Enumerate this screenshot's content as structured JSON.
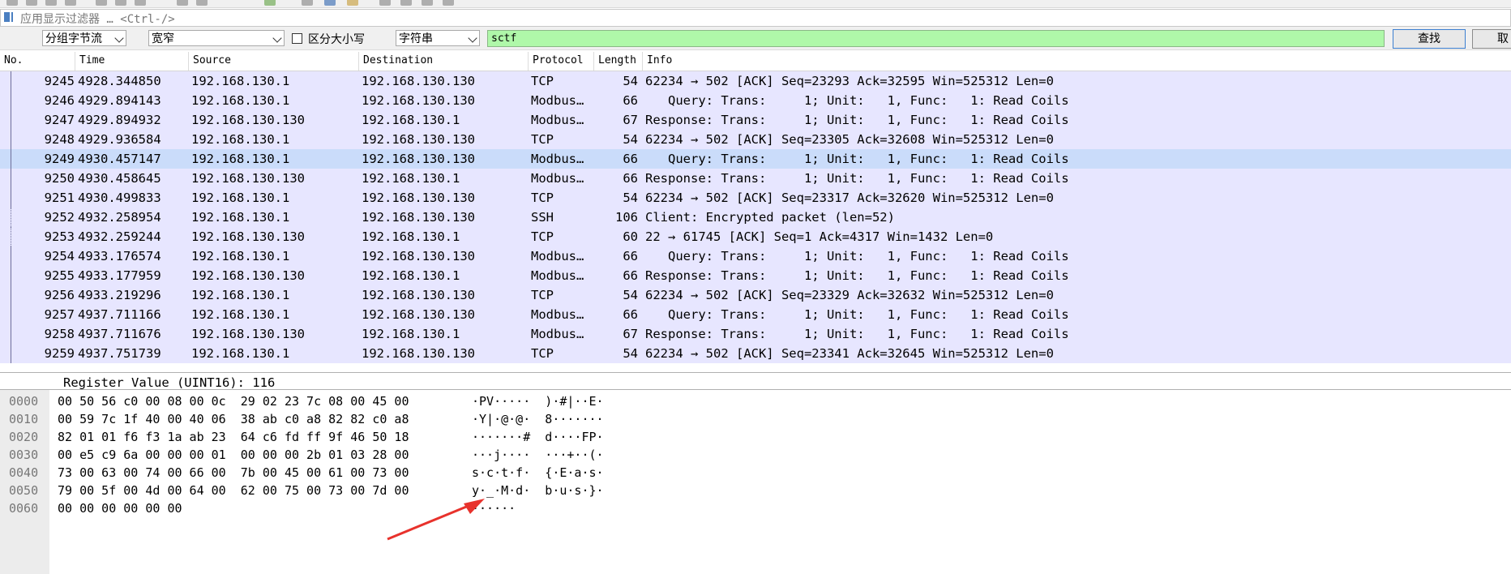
{
  "filter_bar": {
    "placeholder": "应用显示过滤器 … <Ctrl-/>"
  },
  "find_bar": {
    "search_in": "分组字节流",
    "char_width": "宽窄",
    "case_sensitive_label": "区分大小写",
    "search_type": "字符串",
    "search_value": "sctf",
    "find_label": "查找",
    "cancel_label": "取"
  },
  "packet_list": {
    "columns": [
      "No.",
      "Time",
      "Source",
      "Destination",
      "Protocol",
      "Length",
      "Info"
    ],
    "selected_no": "9249",
    "rows": [
      {
        "no": "9245",
        "time": "4928.344850",
        "src": "192.168.130.1",
        "dst": "192.168.130.130",
        "proto": "TCP",
        "len": "54",
        "info": "62234 → 502 [ACK] Seq=23293 Ack=32595 Win=525312 Len=0"
      },
      {
        "no": "9246",
        "time": "4929.894143",
        "src": "192.168.130.1",
        "dst": "192.168.130.130",
        "proto": "Modbus…",
        "len": "66",
        "info": "   Query: Trans:     1; Unit:   1, Func:   1: Read Coils"
      },
      {
        "no": "9247",
        "time": "4929.894932",
        "src": "192.168.130.130",
        "dst": "192.168.130.1",
        "proto": "Modbus…",
        "len": "67",
        "info": "Response: Trans:     1; Unit:   1, Func:   1: Read Coils"
      },
      {
        "no": "9248",
        "time": "4929.936584",
        "src": "192.168.130.1",
        "dst": "192.168.130.130",
        "proto": "TCP",
        "len": "54",
        "info": "62234 → 502 [ACK] Seq=23305 Ack=32608 Win=525312 Len=0"
      },
      {
        "no": "9249",
        "time": "4930.457147",
        "src": "192.168.130.1",
        "dst": "192.168.130.130",
        "proto": "Modbus…",
        "len": "66",
        "info": "   Query: Trans:     1; Unit:   1, Func:   1: Read Coils"
      },
      {
        "no": "9250",
        "time": "4930.458645",
        "src": "192.168.130.130",
        "dst": "192.168.130.1",
        "proto": "Modbus…",
        "len": "66",
        "info": "Response: Trans:     1; Unit:   1, Func:   1: Read Coils"
      },
      {
        "no": "9251",
        "time": "4930.499833",
        "src": "192.168.130.1",
        "dst": "192.168.130.130",
        "proto": "TCP",
        "len": "54",
        "info": "62234 → 502 [ACK] Seq=23317 Ack=32620 Win=525312 Len=0"
      },
      {
        "no": "9252",
        "time": "4932.258954",
        "src": "192.168.130.1",
        "dst": "192.168.130.130",
        "proto": "SSH",
        "len": "106",
        "info": "Client: Encrypted packet (len=52)"
      },
      {
        "no": "9253",
        "time": "4932.259244",
        "src": "192.168.130.130",
        "dst": "192.168.130.1",
        "proto": "TCP",
        "len": "60",
        "info": "22 → 61745 [ACK] Seq=1 Ack=4317 Win=1432 Len=0"
      },
      {
        "no": "9254",
        "time": "4933.176574",
        "src": "192.168.130.1",
        "dst": "192.168.130.130",
        "proto": "Modbus…",
        "len": "66",
        "info": "   Query: Trans:     1; Unit:   1, Func:   1: Read Coils"
      },
      {
        "no": "9255",
        "time": "4933.177959",
        "src": "192.168.130.130",
        "dst": "192.168.130.1",
        "proto": "Modbus…",
        "len": "66",
        "info": "Response: Trans:     1; Unit:   1, Func:   1: Read Coils"
      },
      {
        "no": "9256",
        "time": "4933.219296",
        "src": "192.168.130.1",
        "dst": "192.168.130.130",
        "proto": "TCP",
        "len": "54",
        "info": "62234 → 502 [ACK] Seq=23329 Ack=32632 Win=525312 Len=0"
      },
      {
        "no": "9257",
        "time": "4937.711166",
        "src": "192.168.130.1",
        "dst": "192.168.130.130",
        "proto": "Modbus…",
        "len": "66",
        "info": "   Query: Trans:     1; Unit:   1, Func:   1: Read Coils"
      },
      {
        "no": "9258",
        "time": "4937.711676",
        "src": "192.168.130.130",
        "dst": "192.168.130.1",
        "proto": "Modbus…",
        "len": "67",
        "info": "Response: Trans:     1; Unit:   1, Func:   1: Read Coils"
      },
      {
        "no": "9259",
        "time": "4937.751739",
        "src": "192.168.130.1",
        "dst": "192.168.130.130",
        "proto": "TCP",
        "len": "54",
        "info": "62234 → 502 [ACK] Seq=23341 Ack=32645 Win=525312 Len=0"
      }
    ]
  },
  "details": {
    "visible_line": "Register Value (UINT16): 116"
  },
  "bytes": {
    "rows": [
      {
        "offset": "0000",
        "hex": "00 50 56 c0 00 08 00 0c  29 02 23 7c 08 00 45 00",
        "ascii": "·PV·····  )·#|··E·"
      },
      {
        "offset": "0010",
        "hex": "00 59 7c 1f 40 00 40 06  38 ab c0 a8 82 82 c0 a8",
        "ascii": "·Y|·@·@·  8·······"
      },
      {
        "offset": "0020",
        "hex": "82 01 01 f6 f3 1a ab 23  64 c6 fd ff 9f 46 50 18",
        "ascii": "·······#  d····FP·"
      },
      {
        "offset": "0030",
        "hex": "00 e5 c9 6a 00 00 00 01  00 00 00 2b 01 03 28 00",
        "ascii": "···j····  ···+··(·"
      },
      {
        "offset": "0040",
        "hex": "73 00 63 00 74 00 66 00  7b 00 45 00 61 00 73 00",
        "ascii": "s·c·t·f·  {·E·a·s·"
      },
      {
        "offset": "0050",
        "hex": "79 00 5f 00 4d 00 64 00  62 00 75 00 73 00 7d 00",
        "ascii": "y·_·M·d·  b·u·s·}·"
      },
      {
        "offset": "0060",
        "hex": "00 00 00 00 00 00",
        "ascii": "······"
      }
    ]
  },
  "annotation": {
    "arrow_color": "#e8322c"
  },
  "colors": {
    "row_bg": "#e7e6ff",
    "selected_row_bg": "#cadcfa",
    "search_bg": "#aff8a9"
  }
}
